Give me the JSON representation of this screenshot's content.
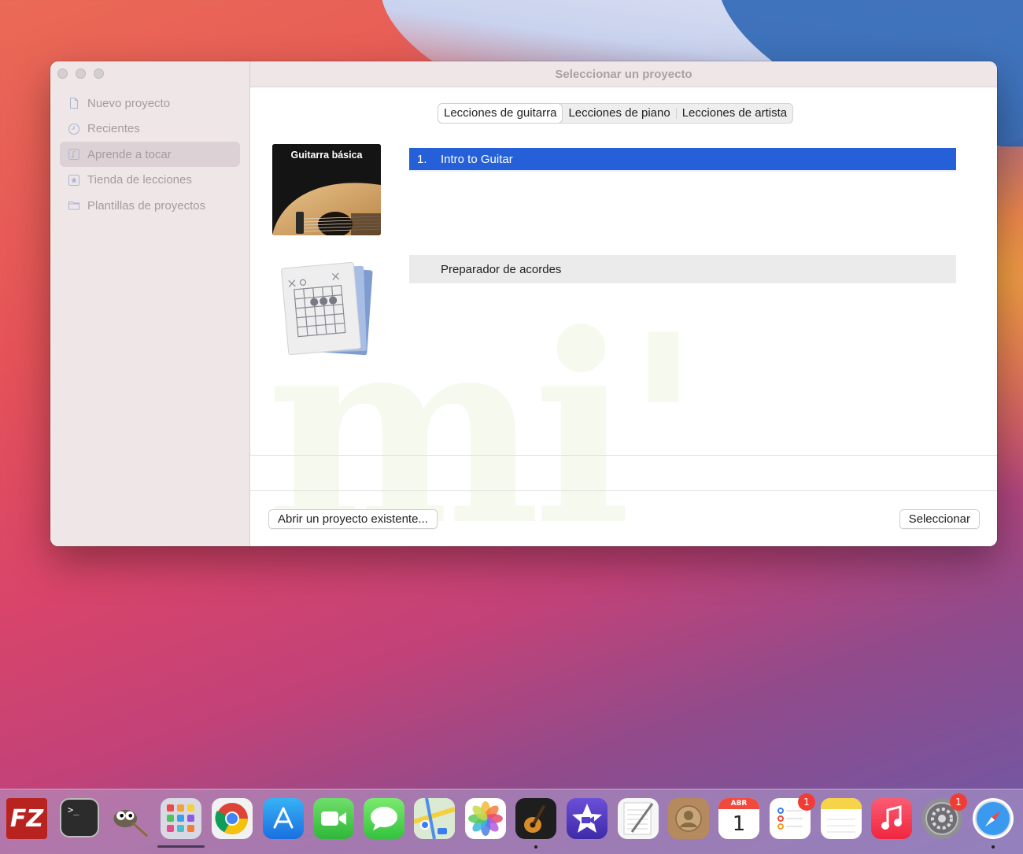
{
  "window": {
    "title": "Seleccionar un proyecto"
  },
  "sidebar": {
    "items": [
      {
        "label": "Nuevo proyecto",
        "icon": "document-icon"
      },
      {
        "label": "Recientes",
        "icon": "clock-icon"
      },
      {
        "label": "Aprende a tocar",
        "icon": "music-note-icon",
        "active": true
      },
      {
        "label": "Tienda de lecciones",
        "icon": "star-icon"
      },
      {
        "label": "Plantillas de proyectos",
        "icon": "folder-icon"
      }
    ]
  },
  "tabs": [
    {
      "label": "Lecciones de guitarra",
      "selected": true
    },
    {
      "label": "Lecciones de piano"
    },
    {
      "label": "Lecciones de artista"
    }
  ],
  "lessons": {
    "guitar_thumb_title": "Guitarra básica",
    "selected_number": "1.",
    "selected_title": "Intro to Guitar",
    "chord_trainer": "Preparador de acordes"
  },
  "buttons": {
    "open_existing": "Abrir un proyecto existente...",
    "select": "Seleccionar"
  },
  "watermark": "mi'",
  "dock": {
    "apps": [
      {
        "name": "FileZilla",
        "icon": "filezilla-icon"
      },
      {
        "name": "Terminal",
        "icon": "terminal-icon"
      },
      {
        "name": "GIMP",
        "icon": "gimp-icon"
      },
      {
        "name": "Launchpad",
        "icon": "launchpad-icon"
      },
      {
        "name": "Chrome",
        "icon": "chrome-icon"
      },
      {
        "name": "App Store",
        "icon": "app-store-icon"
      },
      {
        "name": "FaceTime",
        "icon": "facetime-icon"
      },
      {
        "name": "Mensajes",
        "icon": "messages-icon"
      },
      {
        "name": "Mapas",
        "icon": "maps-icon"
      },
      {
        "name": "Fotos",
        "icon": "photos-icon"
      },
      {
        "name": "GarageBand",
        "icon": "garageband-icon"
      },
      {
        "name": "iMovie",
        "icon": "imovie-icon"
      },
      {
        "name": "TextEdit",
        "icon": "textedit-icon"
      },
      {
        "name": "Contactos",
        "icon": "contacts-icon"
      },
      {
        "name": "Calendario",
        "icon": "calendar-icon"
      },
      {
        "name": "Recordatorios",
        "icon": "reminders-icon"
      },
      {
        "name": "Notas",
        "icon": "notes-icon"
      },
      {
        "name": "Música",
        "icon": "music-icon"
      },
      {
        "name": "Preferencias del Sistema",
        "icon": "system-preferences-icon"
      },
      {
        "name": "Safari",
        "icon": "safari-icon"
      }
    ],
    "calendar_month": "ABR",
    "calendar_day": "1",
    "reminders_badge": "1",
    "system_prefs_badge": "1",
    "terminal_prompt": ">_",
    "filezilla_text": "FZ"
  }
}
